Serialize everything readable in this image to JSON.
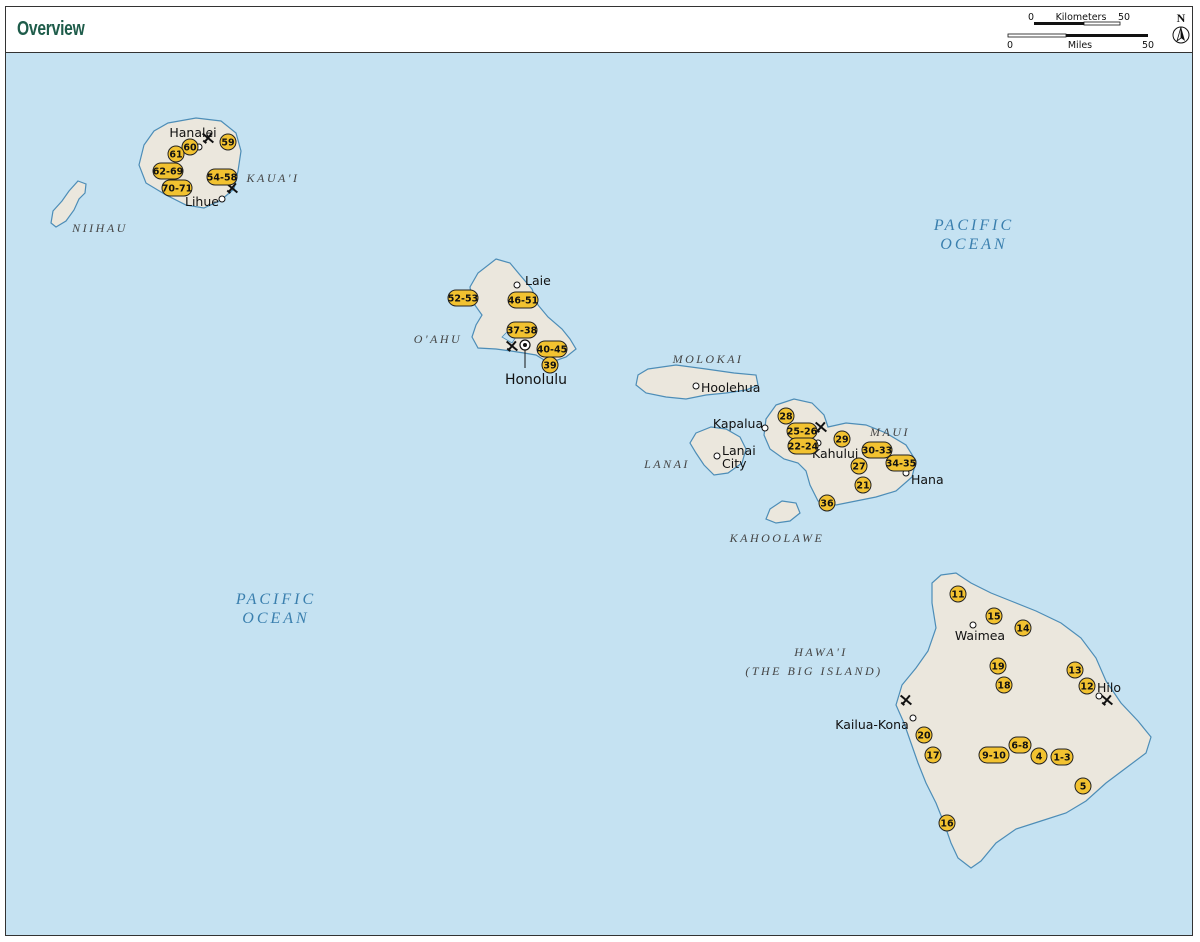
{
  "header": {
    "title": "Overview",
    "scale": {
      "km_label": "Kilometers",
      "km_zero": "0",
      "km_max": "50",
      "mi_label": "Miles",
      "mi_zero": "0",
      "mi_max": "50"
    },
    "north": "N"
  },
  "colors": {
    "ocean": "#c5e2f2",
    "land": "#ebe7dd",
    "coast": "#4d8db7",
    "badge": "#f2c230",
    "title": "#1e5c4a",
    "ocean_label": "#3a7fae"
  },
  "oceans": [
    {
      "line1": "PACIFIC",
      "line2": "OCEAN"
    },
    {
      "line1": "PACIFIC",
      "line2": "OCEAN"
    }
  ],
  "islands": [
    "NIIHAU",
    "KAUA'I",
    "O'AHU",
    "MOLOKAI",
    "LANAI",
    "MAUI",
    "KAHOOLAWE",
    "HAWA'I",
    "(THE BIG ISLAND)"
  ],
  "towns": [
    "Hanalei",
    "Lihue",
    "Laie",
    "Honolulu",
    "Hoolehua",
    "Kapalua",
    "Lanai",
    "City",
    "Kahului",
    "Hana",
    "Waimea",
    "Hilo",
    "Kailua-Kona"
  ],
  "markers": [
    "59",
    "60",
    "61",
    "62-69",
    "54-58",
    "70-71",
    "52-53",
    "46-51",
    "37-38",
    "40-45",
    "39",
    "28",
    "25-26",
    "22-24",
    "29",
    "30-33",
    "34-35",
    "27",
    "21",
    "36",
    "11",
    "15",
    "14",
    "19",
    "13",
    "12",
    "18",
    "20",
    "17",
    "9-10",
    "6-8",
    "4",
    "1-3",
    "5",
    "16"
  ],
  "icons": [
    "airport-icon",
    "capital-icon",
    "town-icon",
    "north-arrow-icon"
  ]
}
